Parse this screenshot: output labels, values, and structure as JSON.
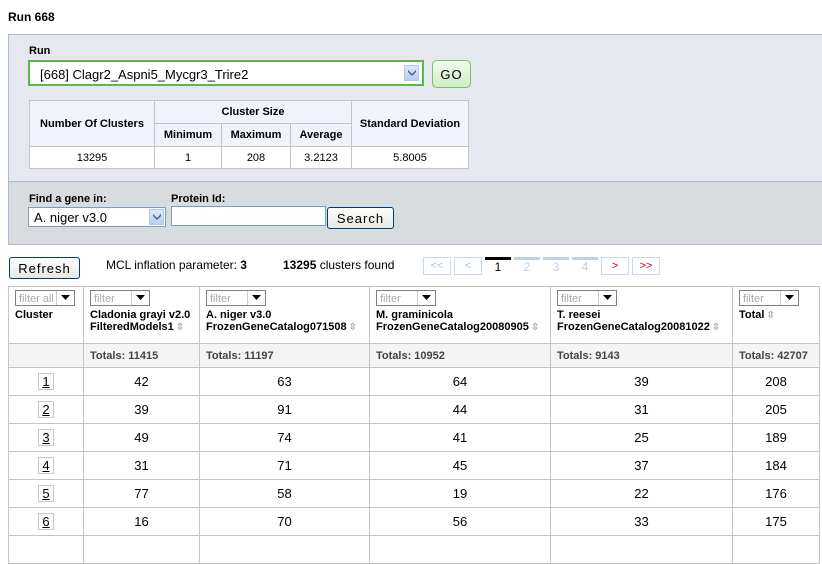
{
  "page": {
    "title": "Run 668"
  },
  "run_form": {
    "run_label": "Run",
    "run_selected": "[668] Clagr2_Aspni5_Mycgr3_Trire2",
    "go_label": "GO"
  },
  "stats": {
    "headers": {
      "num_clusters": "Number Of Clusters",
      "cluster_size": "Cluster Size",
      "minimum": "Minimum",
      "maximum": "Maximum",
      "average": "Average",
      "std_dev": "Standard Deviation"
    },
    "values": {
      "num_clusters": "13295",
      "minimum": "1",
      "maximum": "208",
      "average": "3.2123",
      "std_dev": "5.8005"
    }
  },
  "gene_search": {
    "find_label": "Find a gene in:",
    "genome_selected": "A. niger v3.0",
    "protein_label": "Protein Id:",
    "protein_value": "",
    "search_label": "Search"
  },
  "toolbar": {
    "refresh_label": "Refresh",
    "mcl_label": "MCL inflation parameter:",
    "mcl_value": "3",
    "clusters_count": "13295",
    "clusters_found_label": "clusters found"
  },
  "pager": {
    "first": "<<",
    "prev": "<",
    "pages": [
      "1",
      "2",
      "3",
      "4"
    ],
    "current": "1",
    "next": ">",
    "last": ">>"
  },
  "grid": {
    "filter_all_placeholder": "filter all",
    "filter_placeholder": "filter",
    "columns": [
      {
        "line1": "Cluster",
        "line2": "",
        "total": ""
      },
      {
        "line1": "Cladonia grayi v2.0",
        "line2": "FilteredModels1",
        "total": "Totals: 11415"
      },
      {
        "line1": "A. niger v3.0",
        "line2": "FrozenGeneCatalog071508",
        "total": "Totals: 11197"
      },
      {
        "line1": "M. graminicola",
        "line2": "FrozenGeneCatalog20080905",
        "total": "Totals: 10952"
      },
      {
        "line1": "T. reesei",
        "line2": "FrozenGeneCatalog20081022",
        "total": "Totals: 9143"
      },
      {
        "line1": "Total",
        "line2": "",
        "total": "Totals: 42707"
      }
    ],
    "rows": [
      [
        "1",
        "42",
        "63",
        "64",
        "39",
        "208"
      ],
      [
        "2",
        "39",
        "91",
        "44",
        "31",
        "205"
      ],
      [
        "3",
        "49",
        "74",
        "41",
        "25",
        "189"
      ],
      [
        "4",
        "31",
        "71",
        "45",
        "37",
        "184"
      ],
      [
        "5",
        "77",
        "58",
        "19",
        "22",
        "176"
      ],
      [
        "6",
        "16",
        "70",
        "56",
        "33",
        "175"
      ]
    ]
  }
}
